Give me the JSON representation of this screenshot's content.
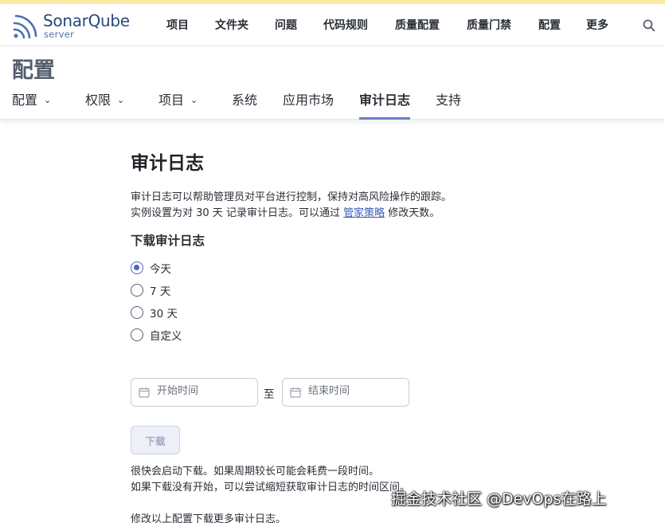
{
  "logo": {
    "name": "SonarQube",
    "sub": "server"
  },
  "topnav": {
    "items": [
      "项目",
      "文件夹",
      "问题",
      "代码规则",
      "质量配置",
      "质量门禁",
      "配置",
      "更多"
    ]
  },
  "header": {
    "title": "配置",
    "tabs": [
      {
        "label": "配置",
        "dropdown": true
      },
      {
        "label": "权限",
        "dropdown": true
      },
      {
        "label": "项目",
        "dropdown": true
      },
      {
        "label": "系统",
        "dropdown": false
      },
      {
        "label": "应用市场",
        "dropdown": false
      },
      {
        "label": "审计日志",
        "dropdown": false,
        "active": true
      },
      {
        "label": "支持",
        "dropdown": false
      }
    ]
  },
  "main": {
    "title": "审计日志",
    "desc_line1": "审计日志可以帮助管理员对平台进行控制，保持对高风险操作的跟踪。",
    "desc_line2_pre": "实例设置为对 30 天 记录审计日志。可以通过 ",
    "desc_link": "管家策略",
    "desc_line2_post": " 修改天数。",
    "download_title": "下载审计日志",
    "options": [
      {
        "label": "今天",
        "checked": true
      },
      {
        "label": "7 天",
        "checked": false
      },
      {
        "label": "30 天",
        "checked": false
      },
      {
        "label": "自定义",
        "checked": false
      }
    ],
    "start_placeholder": "开始时间",
    "to_label": "至",
    "end_placeholder": "结束时间",
    "download_label": "下载",
    "note1": "很快会启动下载。如果周期较长可能会耗费一段时间。",
    "note2": "如果下载没有开始，可以尝试缩短获取审计日志的时间区间。",
    "note3": "修改以上配置下载更多审计日志。"
  },
  "watermark": "掘金技术社区 @DevOps在路上",
  "colors": {
    "accent": "#4f63c2",
    "tab_underline": "#6b7fc6",
    "link": "#3a5db8"
  }
}
